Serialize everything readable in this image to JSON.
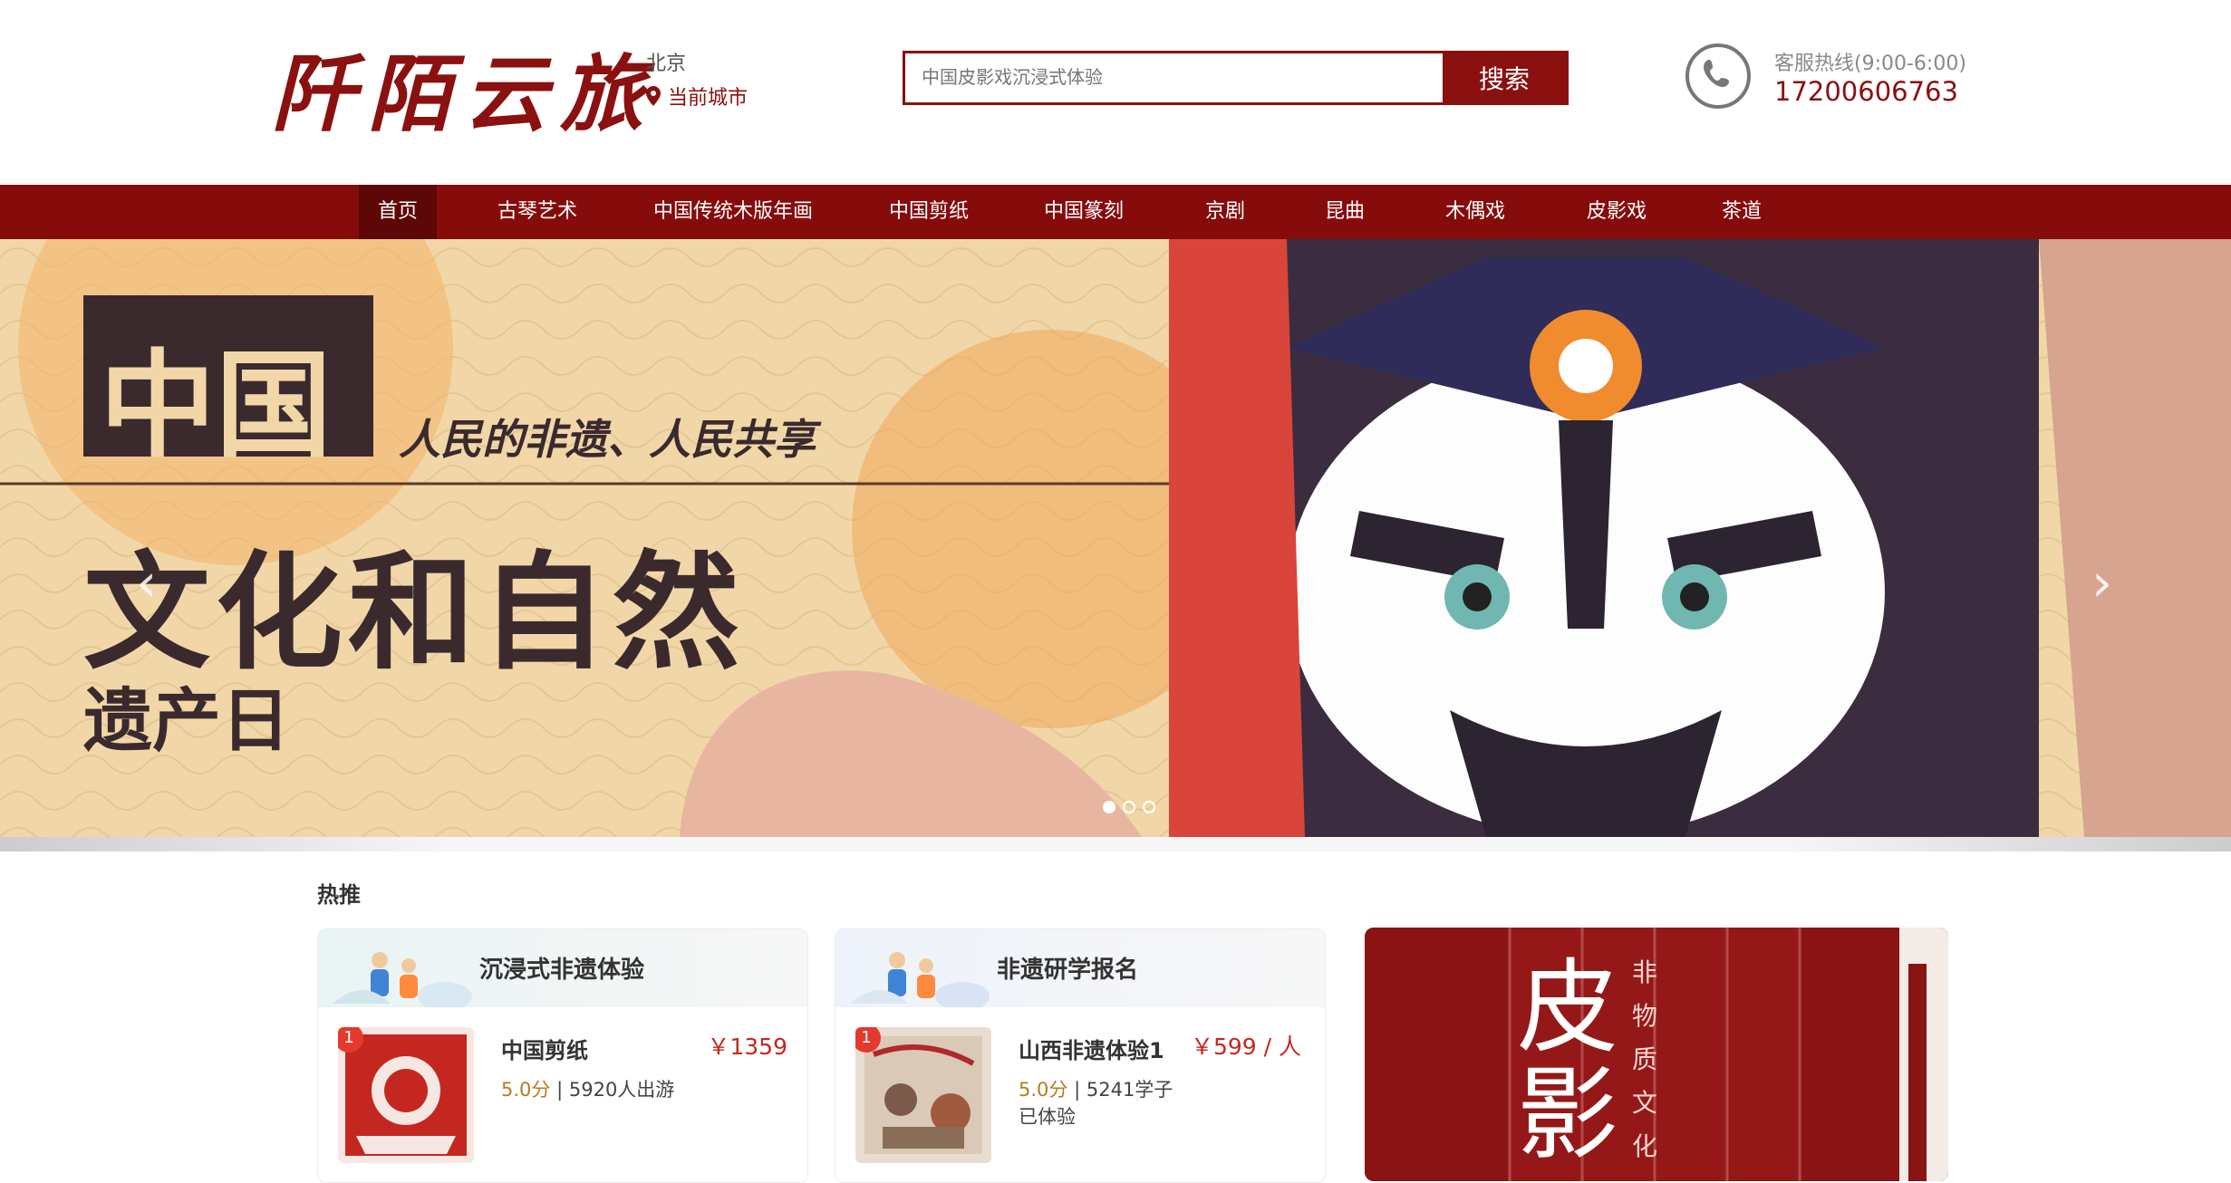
{
  "brand": {
    "logo_text": "阡陌云旅"
  },
  "location": {
    "city": "北京",
    "current_city_label": "当前城市"
  },
  "search": {
    "placeholder": "中国皮影戏沉浸式体验",
    "button_label": "搜索"
  },
  "hotline": {
    "label": "客服热线(9:00-6:00)",
    "number": "17200606763"
  },
  "nav": {
    "items": [
      {
        "label": "首页",
        "active": true
      },
      {
        "label": "古琴艺术"
      },
      {
        "label": "中国传统木版年画"
      },
      {
        "label": "中国剪纸"
      },
      {
        "label": "中国篆刻"
      },
      {
        "label": "京剧"
      },
      {
        "label": "昆曲"
      },
      {
        "label": "木偶戏"
      },
      {
        "label": "皮影戏"
      },
      {
        "label": "茶道"
      }
    ]
  },
  "banner": {
    "title_top": "中国",
    "slogan": "人民的非遗、人民共享",
    "title_main": "文化和自然",
    "title_sub": "遗产日",
    "prev_icon": "chevron-left-icon",
    "next_icon": "chevron-right-icon",
    "slide_count": 3,
    "active_slide": 1
  },
  "hot": {
    "title": "热推",
    "cards": [
      {
        "header": "沉浸式非遗体验",
        "item": {
          "rank": "1",
          "name": "中国剪纸",
          "price": "￥1359",
          "score": "5.0分",
          "stats": "5920人出游"
        }
      },
      {
        "header": "非遗研学报名",
        "item": {
          "rank": "1",
          "name": "山西非遗体验1",
          "price": "￥599 / 人",
          "score": "5.0分",
          "stats": "5241学子已体验"
        }
      }
    ],
    "poster": {
      "big_text": "皮影",
      "vertical_text": "非物质文化"
    }
  },
  "colors": {
    "brand": "#8b1010",
    "nav_bg": "#860c0c",
    "nav_active": "#5d0707",
    "price": "#c8261f"
  }
}
